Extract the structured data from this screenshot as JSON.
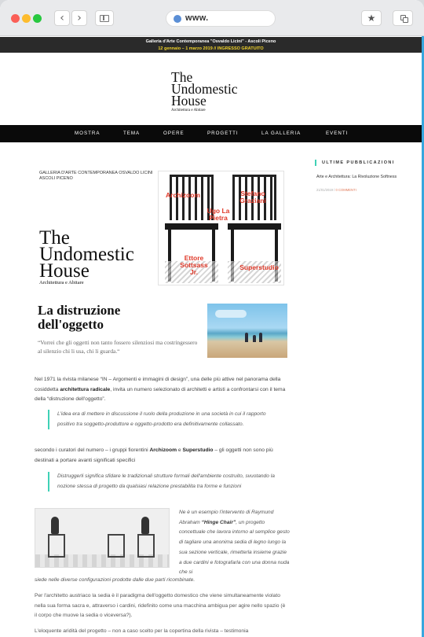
{
  "browser": {
    "url_text": "www.",
    "back_icon": "chevron-left-icon",
    "forward_icon": "chevron-right-icon",
    "star_glyph": "★"
  },
  "topbar": {
    "line1": "Galleria d'Arte Contemporanea \"Osvaldo Licini\" - Ascoli Piceno",
    "line2": "12 gennaio – 1 marzo 2019 // INGRESSO GRATUITO"
  },
  "logo": {
    "line1": "The",
    "line2": "Undomestic",
    "line3": "House",
    "subtitle": "Architettura e Abitare"
  },
  "nav": {
    "items": [
      "MOSTRA",
      "TEMA",
      "OPERE",
      "PROGETTI",
      "LA GALLERIA",
      "EVENTI"
    ]
  },
  "hero": {
    "gallery_line1": "GALLERIA D'ARTE CONTEMPORANEA OSVALDO LICINI",
    "gallery_line2": "ASCOLI PICENO",
    "chair_names": [
      "Archizoom",
      "Ugo La Pietra",
      "Stefano Graziani",
      "Ettore Sottsass Jr.",
      "Superstudio"
    ]
  },
  "article": {
    "title_line1": "La distruzione",
    "title_line2": "dell'oggetto",
    "quote": "“Vorrei che gli oggetti non tanto fossero silenziosi ma costringessero al silenzio chi li usa, chi li guarda.“",
    "p1_a": "Nel 1971 la rivista milanese “IN – Argomenti e immagini di design”, una delle più attive nel panorama della cosiddetta ",
    "p1_b": "architettura radicale",
    "p1_c": ", invita un numero selezionato di architetti e artisti a confrontarsi con il tema della “distruzione dell'oggetto”.",
    "bq1": "L'idea era di mettere in discussione il ruolo della produzione in una società in cui il rapporto positivo tra soggetto-produttore e oggetto-prodotto era definitivamente collassato.",
    "p2_a": "secondo i curatori del numero – i gruppi fiorentini ",
    "p2_b": "Archizoom",
    "p2_c": " e ",
    "p2_d": "Superstudio",
    "p2_e": " – gli oggetti non sono più destinati a portare avanti significati specifici",
    "bq2": "Distruggerli significa sfidare le tradizionali strutture formali dell'ambiente costruito, svuotando la nozione stessa di progetto da qualsiasi relazione prestabilita tra forme e funzioni",
    "side_a": "Ne è un esempio l'intervento di Raymund Abraham ",
    "side_b": "“Hinge Chair”",
    "side_c": ", un progetto concettuale che lavora intorno al semplice gesto di tagliare una anonima sedia di legno lungo la sua sezione verticale, rimetterla insieme grazie a due cardini e fotografarla con una donna nuda che si",
    "side_d": "siede nelle diverse configurazioni prodotte dalle due parti ricombinate.",
    "p3": "Per l'architetto austriaco la sedia è il paradigma dell'oggetto domestico che viene simultaneamente violato nella sua forma sacra e, attraverso i cardini, ridefinito come una macchina ambigua per agire nello spazio (è il corpo che muove la sedia o viceversa?).",
    "p4": "L'eloquente aridità del progetto – non a caso scelto per la copertina della rivista – testimonia"
  },
  "sidebar": {
    "heading": "ULTIME PUBBLICAZIONI",
    "post_title": "Arte e Architettura: La Rivoluzione Softness",
    "post_date": "21/01/2019",
    "post_comments": "0 COMMENTI"
  },
  "colors": {
    "accent": "#3fd1b6",
    "scrollbar": "#37a7de",
    "topbar_bg": "#2a2a2a",
    "topbar_highlight": "#f0d22a",
    "chair_label": "#e03a2a"
  }
}
